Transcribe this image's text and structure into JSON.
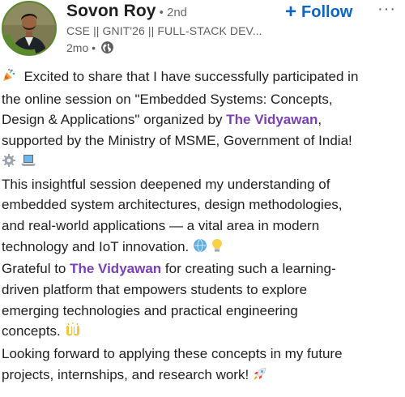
{
  "author": {
    "name": "Sovon Roy",
    "degree": "• 2nd",
    "headline": "CSE || GNIT'26 || FULL-STACK DEV...",
    "time": "2mo •",
    "avatar_badge_text": "#OPENTOWORK"
  },
  "actions": {
    "follow_label": "Follow",
    "more_label": "···"
  },
  "post": {
    "p1_l1": "Excited to share that I have successfully participated in",
    "p1_l2": "the online session on \"Embedded Systems: Concepts,",
    "p1_l3_pre": "Design & Applications\" organized by ",
    "p1_l3_mention": "The Vidyawan",
    "p1_l3_post": ",",
    "p1_l4": "supported by the Ministry of MSME, Government of India!",
    "p2_l1": "This insightful session deepened my understanding of",
    "p2_l2": "embedded system architectures, design methodologies,",
    "p2_l3": "and real-world applications — a vital area in modern",
    "p2_l4": "technology and IoT innovation.",
    "p3_l1_pre": "Grateful to ",
    "p3_l1_mention": "The Vidyawan",
    "p3_l1_post": " for creating such a learning-",
    "p3_l2": "driven platform that empowers students to explore",
    "p3_l3": "emerging technologies and practical engineering",
    "p3_l4": "concepts.",
    "p4_l1": "Looking forward to applying these concepts in my future",
    "p4_l2": "projects, internships, and research work!"
  },
  "colors": {
    "link_blue": "#0a66c2",
    "mention_purple": "#7b3fb5",
    "muted_text": "#5e5e5e",
    "opentowork_green": "#5b8a2e"
  }
}
